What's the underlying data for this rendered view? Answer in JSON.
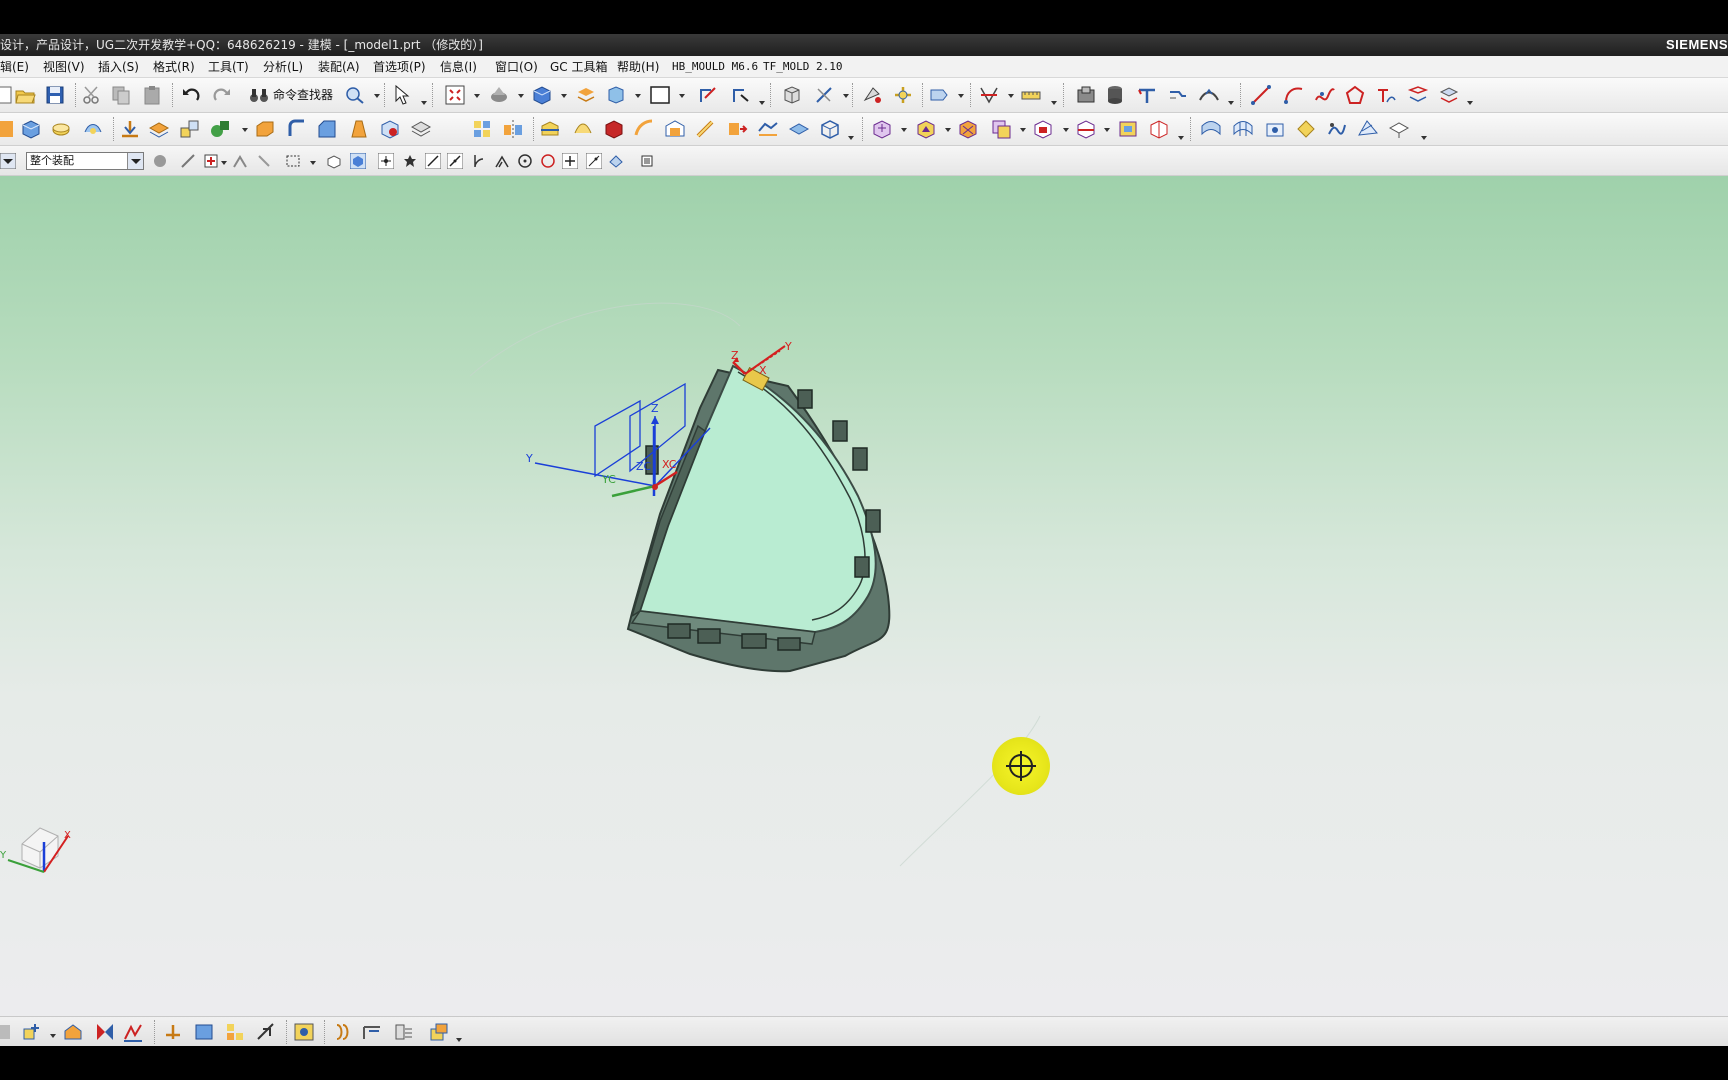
{
  "window": {
    "title": "设计，产品设计，UG二次开发教学+QQ：648626219 - 建模 - [_model1.prt （修改的）]",
    "brand": "SIEMENS"
  },
  "menu": {
    "items": [
      "辑(E)",
      "视图(V)",
      "插入(S)",
      "格式(R)",
      "工具(T)",
      "分析(L)",
      "装配(A)",
      "首选项(P)",
      "信息(I)",
      "窗口(O)",
      "GC 工具箱",
      "帮助(H)",
      "HB_MOULD M6.6",
      "TF_MOLD 2.10"
    ]
  },
  "toolbar": {
    "command_finder_label": "命令查找器"
  },
  "selection_bar": {
    "filter_value": "整个装配"
  },
  "viewport": {
    "colors": {
      "part_fill": "#b9ecd2",
      "part_edge": "#3b4b45",
      "axis_x": "#d42020",
      "axis_y": "#d42020",
      "axis_z": "#1a3fd8",
      "wcs": "#1a3fd8",
      "accent_clip": "#e8c84a"
    },
    "datum_labels": {
      "csys_z": "Z",
      "csys_x": "X",
      "csys_y": "Y",
      "wcs_z": "Z",
      "wcs_y": "Y",
      "wcs_zc": "ZC",
      "wcs_xc": "XC",
      "wcs_yc": "YC",
      "triad_x": "X",
      "triad_y": "Y"
    }
  }
}
